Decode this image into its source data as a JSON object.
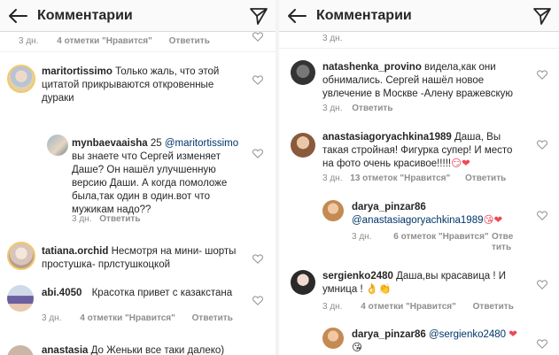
{
  "header": {
    "title": "Комментарии",
    "back_icon": "arrow-left-icon",
    "send_icon": "paper-plane-icon"
  },
  "left": {
    "top_meta": {
      "age": "3 дн.",
      "likes": "4 отметки \"Нравится\"",
      "reply": "Ответить"
    },
    "c1": {
      "user": "maritortissimo",
      "text1": "Только жаль, что этой",
      "text2": "цитатой прикрываются откровенные",
      "text3": "дураки"
    },
    "c2": {
      "user": "mynbaevaaisha",
      "line1_rest": "25",
      "mention": "@maritortissimo",
      "text1": "вы знаете что Сергей изменяет",
      "text2": "Даше? Он нашёл улучшенную",
      "text3": "версию Даши. А когда помоложе",
      "text4": "была,так один в один.вот что",
      "text5": "мужикам надо??",
      "age": "3 дн.",
      "reply": "Ответить"
    },
    "c3": {
      "user": "tatiana.orchid",
      "text1": "Несмотря на мини- шорты",
      "text2": "простушка- прлстушкоцкой"
    },
    "c4": {
      "user": "abi.4050",
      "text1": "Красотка привет с казакстана",
      "age": "3 дн.",
      "likes": "4 отметки \"Нравится\"",
      "reply": "Ответить"
    },
    "c5": {
      "user": "anastasia",
      "text1": "До Женьки все таки далеко)"
    }
  },
  "right": {
    "top_meta": {
      "age": "3 дн."
    },
    "c1": {
      "user": "natashenka_provino",
      "text1": "видела,как они",
      "text2": "обнимались. Сергей нашёл новое",
      "text3": "увлечение в Москве -Алену вражевскую",
      "age": "3 дн.",
      "reply": "Ответить"
    },
    "c2": {
      "user": "anastasiagoryachkina1989",
      "text1": "Даша, Вы",
      "text2": "такая стройная! Фигурка супер! И место",
      "text3": "на фото очень красивое!!!!!",
      "emoji": "😏❤",
      "age": "3 дн.",
      "likes": "13 отметок \"Нравится\"",
      "reply": "Ответить"
    },
    "c3": {
      "user": "darya_pinzar86",
      "mention": "@anastasiagoryachkina1989",
      "emoji": "😘❤",
      "age": "3 дн.",
      "likes": "6 отметок \"Нравится\"",
      "reply1": "Отве",
      "reply2": "тить"
    },
    "c4": {
      "user": "sergienko2480",
      "text1": "Даша,вы красавица !  И",
      "text2": "умница !",
      "emoji": "👌👏",
      "age": "3 дн.",
      "likes": "4 отметки \"Нравится\"",
      "reply": "Ответить"
    },
    "c5": {
      "user": "darya_pinzar86",
      "mention": "@sergienko2480",
      "emoji": "❤",
      "emoji2": "😘"
    }
  },
  "colors": {
    "text": "#262626",
    "meta": "#8e8e8e",
    "mention": "#003569",
    "heart_red": "#ed4956"
  }
}
